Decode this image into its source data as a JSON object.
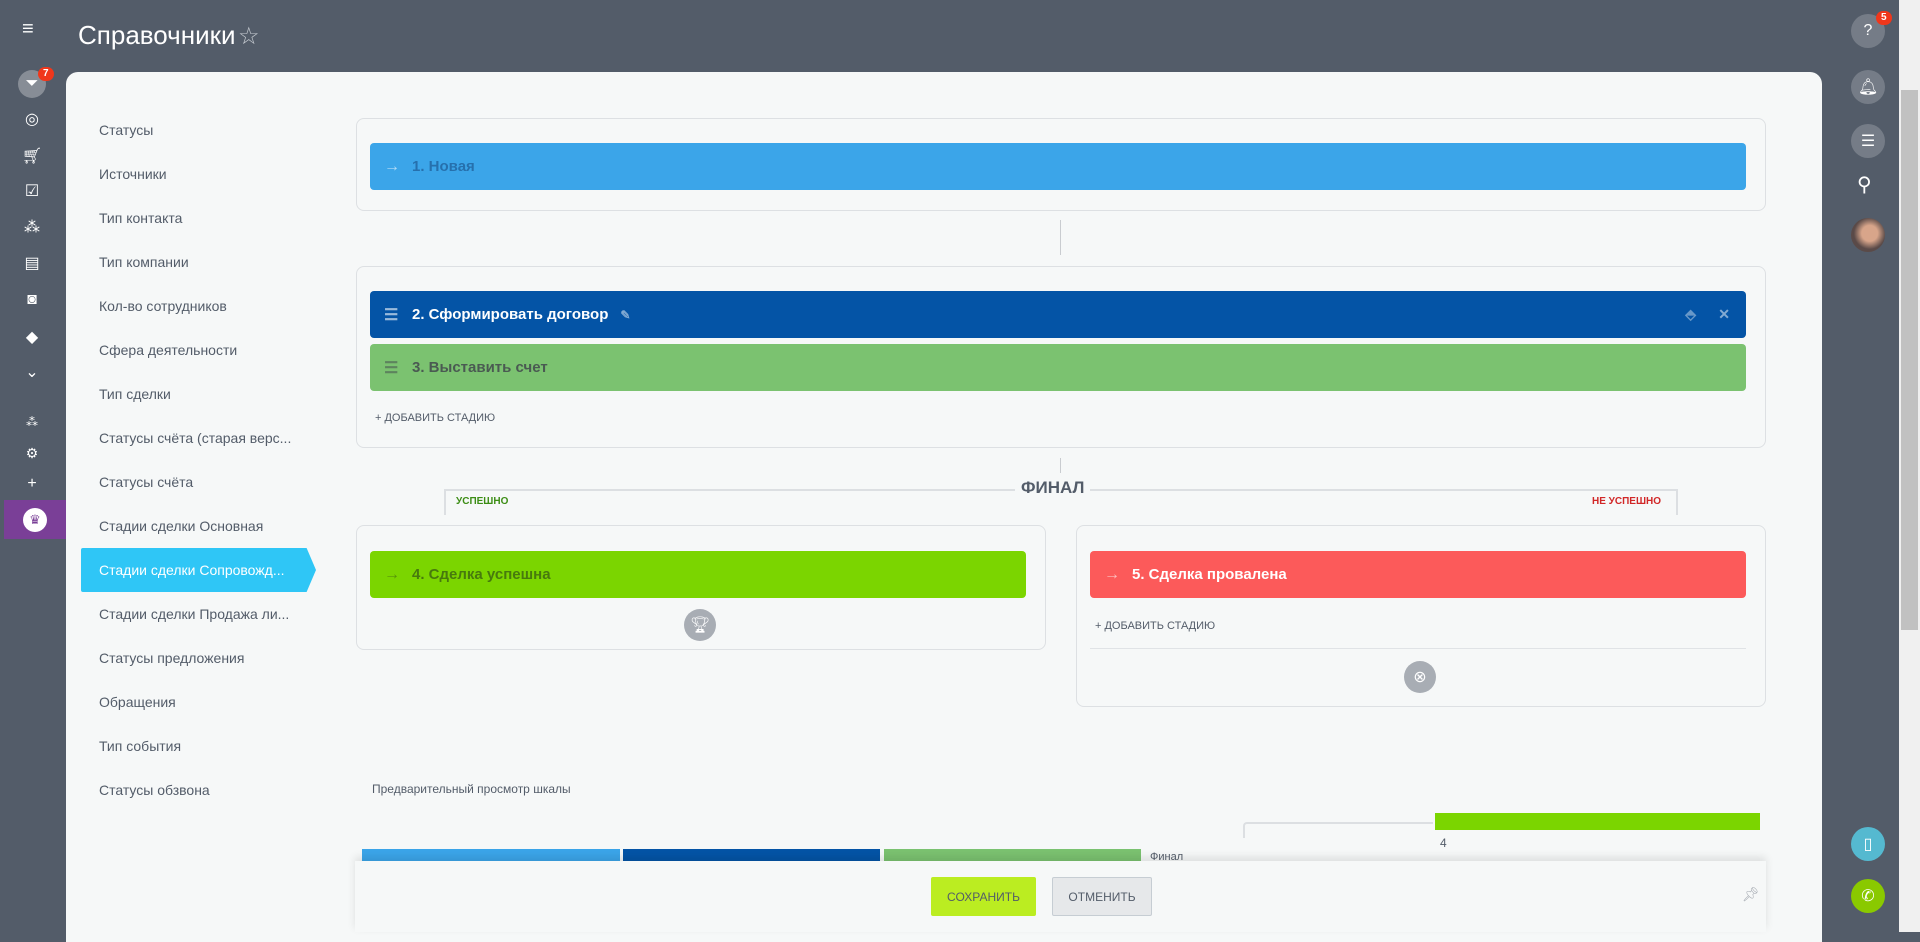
{
  "header": {
    "title": "Справочники"
  },
  "left_bar": {
    "crm_badge": "7"
  },
  "right_bar": {
    "help_badge": "5"
  },
  "nav": {
    "items": [
      "Статусы",
      "Источники",
      "Тип контакта",
      "Тип компании",
      "Кол-во сотрудников",
      "Сфера деятельности",
      "Тип сделки",
      "Статусы счёта (старая верс...",
      "Статусы счёта",
      "Стадии сделки Основная",
      "Стадии сделки Сопровожд...",
      "Стадии сделки Продажа ли...",
      "Статусы предложения",
      "Обращения",
      "Тип события",
      "Статусы обзвона"
    ],
    "active_index": 10
  },
  "stages": {
    "first": {
      "label": "1. Новая",
      "color": "#3ba5e9"
    },
    "middle": [
      {
        "label": "2. Сформировать договор",
        "color": "#0454a6"
      },
      {
        "label": "3. Выставить счет",
        "color": "#7bc270"
      }
    ],
    "add_stage": "+ ДОБАВИТЬ СТАДИЮ",
    "final_title": "ФИНАЛ",
    "success_label": "УСПЕШНО",
    "fail_label": "НЕ УСПЕШНО",
    "success": {
      "label": "4. Сделка успешна",
      "color": "#7bd500"
    },
    "fail": {
      "label": "5. Сделка провалена",
      "color": "#fc5a5a"
    }
  },
  "preview": {
    "title": "Предварительный просмотр шкалы",
    "final_label": "Финал",
    "success_number": "4"
  },
  "footer": {
    "save": "СОХРАНИТЬ",
    "cancel": "ОТМЕНИТЬ"
  }
}
